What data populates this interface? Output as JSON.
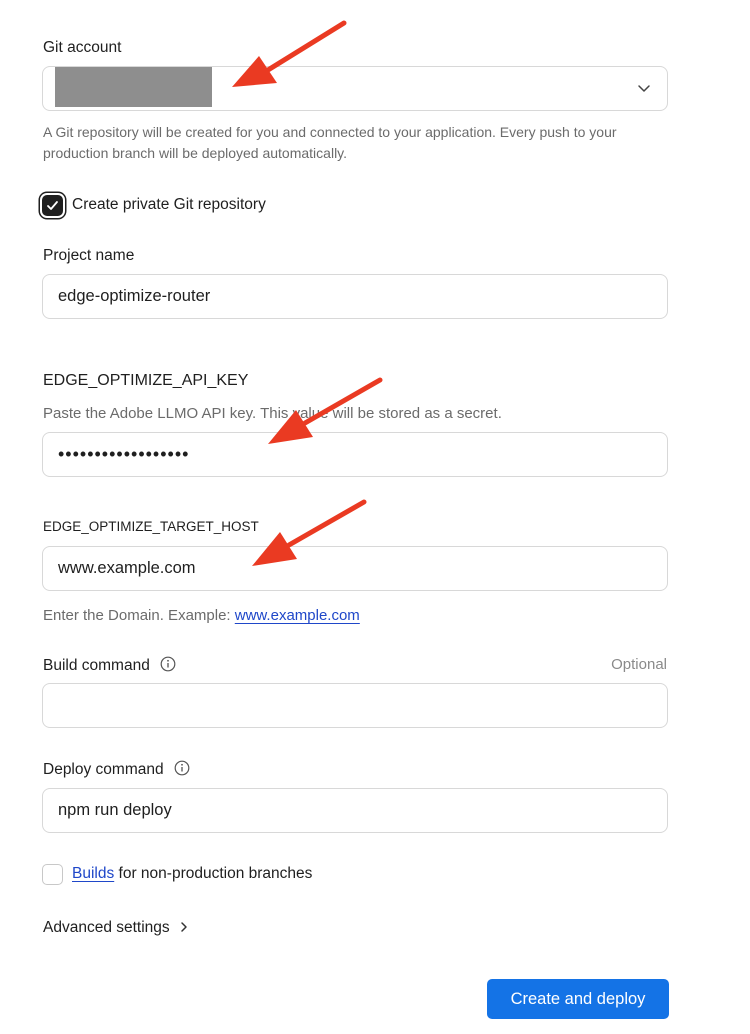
{
  "git_account": {
    "label": "Git account",
    "help": "A Git repository will be created for you and connected to your application. Every push to your production branch will be deployed automatically.",
    "icon": "chevron-down-icon"
  },
  "private_repo": {
    "label": "Create private Git repository",
    "checked": true
  },
  "project_name": {
    "label": "Project name",
    "value": "edge-optimize-router"
  },
  "api_key": {
    "label": "EDGE_OPTIMIZE_API_KEY",
    "help": "Paste the Adobe LLMO API key. This value will be stored as a secret.",
    "masked_value": "••••••••••••••••••"
  },
  "target_host": {
    "label": "EDGE_OPTIMIZE_TARGET_HOST",
    "value": "www.example.com",
    "help_prefix": "Enter the Domain. Example: ",
    "help_link": "www.example.com"
  },
  "build_command": {
    "label": "Build command",
    "optional": "Optional",
    "value": ""
  },
  "deploy_command": {
    "label": "Deploy command",
    "value": "npm run deploy"
  },
  "builds_option": {
    "link": "Builds",
    "suffix": " for non-production branches",
    "checked": false
  },
  "advanced": {
    "label": "Advanced settings"
  },
  "submit": {
    "label": "Create and deploy"
  },
  "colors": {
    "primary": "#1473e6",
    "annotation_arrow": "#ea3a22",
    "link": "#1f47c9"
  }
}
